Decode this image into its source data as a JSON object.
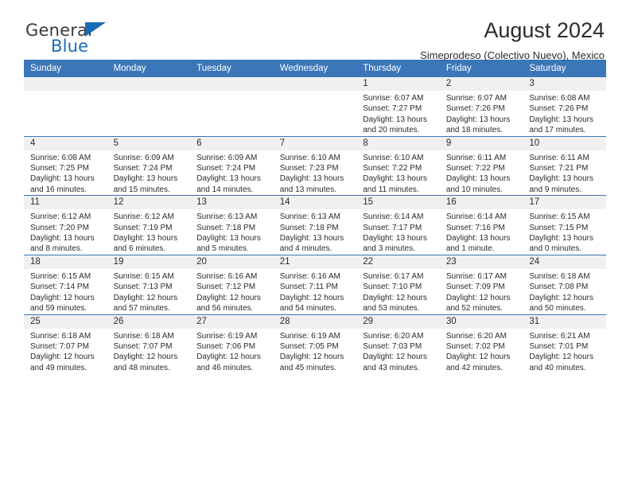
{
  "brand": {
    "line1": "General",
    "line2": "Blue",
    "triangle_icon": "blue-triangle-icon",
    "accent_color": "#1b6cb5"
  },
  "header": {
    "title": "August 2024",
    "subtitle": "Simeprodeso (Colectivo Nuevo), Mexico"
  },
  "calendar": {
    "header_color": "#3b76b8",
    "daynum_band_color": "#f0f0f0",
    "weekday_headers": [
      "Sunday",
      "Monday",
      "Tuesday",
      "Wednesday",
      "Thursday",
      "Friday",
      "Saturday"
    ],
    "weeks": [
      [
        {
          "day": "",
          "sunrise": "",
          "sunset": "",
          "daylight_line1": "",
          "daylight_line2": ""
        },
        {
          "day": "",
          "sunrise": "",
          "sunset": "",
          "daylight_line1": "",
          "daylight_line2": ""
        },
        {
          "day": "",
          "sunrise": "",
          "sunset": "",
          "daylight_line1": "",
          "daylight_line2": ""
        },
        {
          "day": "",
          "sunrise": "",
          "sunset": "",
          "daylight_line1": "",
          "daylight_line2": ""
        },
        {
          "day": "1",
          "sunrise": "Sunrise: 6:07 AM",
          "sunset": "Sunset: 7:27 PM",
          "daylight_line1": "Daylight: 13 hours",
          "daylight_line2": "and 20 minutes."
        },
        {
          "day": "2",
          "sunrise": "Sunrise: 6:07 AM",
          "sunset": "Sunset: 7:26 PM",
          "daylight_line1": "Daylight: 13 hours",
          "daylight_line2": "and 18 minutes."
        },
        {
          "day": "3",
          "sunrise": "Sunrise: 6:08 AM",
          "sunset": "Sunset: 7:26 PM",
          "daylight_line1": "Daylight: 13 hours",
          "daylight_line2": "and 17 minutes."
        }
      ],
      [
        {
          "day": "4",
          "sunrise": "Sunrise: 6:08 AM",
          "sunset": "Sunset: 7:25 PM",
          "daylight_line1": "Daylight: 13 hours",
          "daylight_line2": "and 16 minutes."
        },
        {
          "day": "5",
          "sunrise": "Sunrise: 6:09 AM",
          "sunset": "Sunset: 7:24 PM",
          "daylight_line1": "Daylight: 13 hours",
          "daylight_line2": "and 15 minutes."
        },
        {
          "day": "6",
          "sunrise": "Sunrise: 6:09 AM",
          "sunset": "Sunset: 7:24 PM",
          "daylight_line1": "Daylight: 13 hours",
          "daylight_line2": "and 14 minutes."
        },
        {
          "day": "7",
          "sunrise": "Sunrise: 6:10 AM",
          "sunset": "Sunset: 7:23 PM",
          "daylight_line1": "Daylight: 13 hours",
          "daylight_line2": "and 13 minutes."
        },
        {
          "day": "8",
          "sunrise": "Sunrise: 6:10 AM",
          "sunset": "Sunset: 7:22 PM",
          "daylight_line1": "Daylight: 13 hours",
          "daylight_line2": "and 11 minutes."
        },
        {
          "day": "9",
          "sunrise": "Sunrise: 6:11 AM",
          "sunset": "Sunset: 7:22 PM",
          "daylight_line1": "Daylight: 13 hours",
          "daylight_line2": "and 10 minutes."
        },
        {
          "day": "10",
          "sunrise": "Sunrise: 6:11 AM",
          "sunset": "Sunset: 7:21 PM",
          "daylight_line1": "Daylight: 13 hours",
          "daylight_line2": "and 9 minutes."
        }
      ],
      [
        {
          "day": "11",
          "sunrise": "Sunrise: 6:12 AM",
          "sunset": "Sunset: 7:20 PM",
          "daylight_line1": "Daylight: 13 hours",
          "daylight_line2": "and 8 minutes."
        },
        {
          "day": "12",
          "sunrise": "Sunrise: 6:12 AM",
          "sunset": "Sunset: 7:19 PM",
          "daylight_line1": "Daylight: 13 hours",
          "daylight_line2": "and 6 minutes."
        },
        {
          "day": "13",
          "sunrise": "Sunrise: 6:13 AM",
          "sunset": "Sunset: 7:18 PM",
          "daylight_line1": "Daylight: 13 hours",
          "daylight_line2": "and 5 minutes."
        },
        {
          "day": "14",
          "sunrise": "Sunrise: 6:13 AM",
          "sunset": "Sunset: 7:18 PM",
          "daylight_line1": "Daylight: 13 hours",
          "daylight_line2": "and 4 minutes."
        },
        {
          "day": "15",
          "sunrise": "Sunrise: 6:14 AM",
          "sunset": "Sunset: 7:17 PM",
          "daylight_line1": "Daylight: 13 hours",
          "daylight_line2": "and 3 minutes."
        },
        {
          "day": "16",
          "sunrise": "Sunrise: 6:14 AM",
          "sunset": "Sunset: 7:16 PM",
          "daylight_line1": "Daylight: 13 hours",
          "daylight_line2": "and 1 minute."
        },
        {
          "day": "17",
          "sunrise": "Sunrise: 6:15 AM",
          "sunset": "Sunset: 7:15 PM",
          "daylight_line1": "Daylight: 13 hours",
          "daylight_line2": "and 0 minutes."
        }
      ],
      [
        {
          "day": "18",
          "sunrise": "Sunrise: 6:15 AM",
          "sunset": "Sunset: 7:14 PM",
          "daylight_line1": "Daylight: 12 hours",
          "daylight_line2": "and 59 minutes."
        },
        {
          "day": "19",
          "sunrise": "Sunrise: 6:15 AM",
          "sunset": "Sunset: 7:13 PM",
          "daylight_line1": "Daylight: 12 hours",
          "daylight_line2": "and 57 minutes."
        },
        {
          "day": "20",
          "sunrise": "Sunrise: 6:16 AM",
          "sunset": "Sunset: 7:12 PM",
          "daylight_line1": "Daylight: 12 hours",
          "daylight_line2": "and 56 minutes."
        },
        {
          "day": "21",
          "sunrise": "Sunrise: 6:16 AM",
          "sunset": "Sunset: 7:11 PM",
          "daylight_line1": "Daylight: 12 hours",
          "daylight_line2": "and 54 minutes."
        },
        {
          "day": "22",
          "sunrise": "Sunrise: 6:17 AM",
          "sunset": "Sunset: 7:10 PM",
          "daylight_line1": "Daylight: 12 hours",
          "daylight_line2": "and 53 minutes."
        },
        {
          "day": "23",
          "sunrise": "Sunrise: 6:17 AM",
          "sunset": "Sunset: 7:09 PM",
          "daylight_line1": "Daylight: 12 hours",
          "daylight_line2": "and 52 minutes."
        },
        {
          "day": "24",
          "sunrise": "Sunrise: 6:18 AM",
          "sunset": "Sunset: 7:08 PM",
          "daylight_line1": "Daylight: 12 hours",
          "daylight_line2": "and 50 minutes."
        }
      ],
      [
        {
          "day": "25",
          "sunrise": "Sunrise: 6:18 AM",
          "sunset": "Sunset: 7:07 PM",
          "daylight_line1": "Daylight: 12 hours",
          "daylight_line2": "and 49 minutes."
        },
        {
          "day": "26",
          "sunrise": "Sunrise: 6:18 AM",
          "sunset": "Sunset: 7:07 PM",
          "daylight_line1": "Daylight: 12 hours",
          "daylight_line2": "and 48 minutes."
        },
        {
          "day": "27",
          "sunrise": "Sunrise: 6:19 AM",
          "sunset": "Sunset: 7:06 PM",
          "daylight_line1": "Daylight: 12 hours",
          "daylight_line2": "and 46 minutes."
        },
        {
          "day": "28",
          "sunrise": "Sunrise: 6:19 AM",
          "sunset": "Sunset: 7:05 PM",
          "daylight_line1": "Daylight: 12 hours",
          "daylight_line2": "and 45 minutes."
        },
        {
          "day": "29",
          "sunrise": "Sunrise: 6:20 AM",
          "sunset": "Sunset: 7:03 PM",
          "daylight_line1": "Daylight: 12 hours",
          "daylight_line2": "and 43 minutes."
        },
        {
          "day": "30",
          "sunrise": "Sunrise: 6:20 AM",
          "sunset": "Sunset: 7:02 PM",
          "daylight_line1": "Daylight: 12 hours",
          "daylight_line2": "and 42 minutes."
        },
        {
          "day": "31",
          "sunrise": "Sunrise: 6:21 AM",
          "sunset": "Sunset: 7:01 PM",
          "daylight_line1": "Daylight: 12 hours",
          "daylight_line2": "and 40 minutes."
        }
      ]
    ]
  }
}
